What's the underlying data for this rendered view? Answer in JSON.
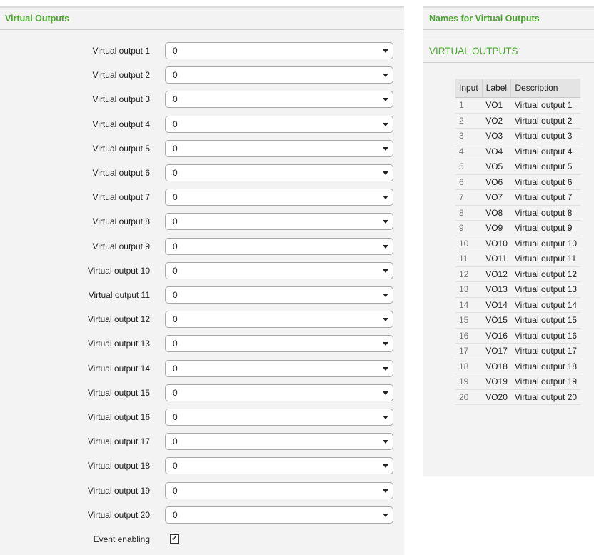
{
  "left": {
    "title": "Virtual Outputs",
    "outputs": [
      {
        "label": "Virtual output 1",
        "value": "0"
      },
      {
        "label": "Virtual output 2",
        "value": "0"
      },
      {
        "label": "Virtual output 3",
        "value": "0"
      },
      {
        "label": "Virtual output 4",
        "value": "0"
      },
      {
        "label": "Virtual output 5",
        "value": "0"
      },
      {
        "label": "Virtual output 6",
        "value": "0"
      },
      {
        "label": "Virtual output 7",
        "value": "0"
      },
      {
        "label": "Virtual output 8",
        "value": "0"
      },
      {
        "label": "Virtual output 9",
        "value": "0"
      },
      {
        "label": "Virtual output 10",
        "value": "0"
      },
      {
        "label": "Virtual output 11",
        "value": "0"
      },
      {
        "label": "Virtual output 12",
        "value": "0"
      },
      {
        "label": "Virtual output 13",
        "value": "0"
      },
      {
        "label": "Virtual output 14",
        "value": "0"
      },
      {
        "label": "Virtual output 15",
        "value": "0"
      },
      {
        "label": "Virtual output 16",
        "value": "0"
      },
      {
        "label": "Virtual output 17",
        "value": "0"
      },
      {
        "label": "Virtual output 18",
        "value": "0"
      },
      {
        "label": "Virtual output 19",
        "value": "0"
      },
      {
        "label": "Virtual output 20",
        "value": "0"
      }
    ],
    "event_enabling": {
      "label": "Event enabling",
      "checked": true,
      "mark": "✓"
    }
  },
  "right": {
    "title": "Names for Virtual Outputs",
    "subtitle": "VIRTUAL OUTPUTS",
    "columns": [
      "Input",
      "Label",
      "Description"
    ],
    "rows": [
      [
        "1",
        "VO1",
        "Virtual output 1"
      ],
      [
        "2",
        "VO2",
        "Virtual output 2"
      ],
      [
        "3",
        "VO3",
        "Virtual output 3"
      ],
      [
        "4",
        "VO4",
        "Virtual output 4"
      ],
      [
        "5",
        "VO5",
        "Virtual output 5"
      ],
      [
        "6",
        "VO6",
        "Virtual output 6"
      ],
      [
        "7",
        "VO7",
        "Virtual output 7"
      ],
      [
        "8",
        "VO8",
        "Virtual output 8"
      ],
      [
        "9",
        "VO9",
        "Virtual output 9"
      ],
      [
        "10",
        "VO10",
        "Virtual output 10"
      ],
      [
        "11",
        "VO11",
        "Virtual output 11"
      ],
      [
        "12",
        "VO12",
        "Virtual output 12"
      ],
      [
        "13",
        "VO13",
        "Virtual output 13"
      ],
      [
        "14",
        "VO14",
        "Virtual output 14"
      ],
      [
        "15",
        "VO15",
        "Virtual output 15"
      ],
      [
        "16",
        "VO16",
        "Virtual output 16"
      ],
      [
        "17",
        "VO17",
        "Virtual output 17"
      ],
      [
        "18",
        "VO18",
        "Virtual output 18"
      ],
      [
        "19",
        "VO19",
        "Virtual output 19"
      ],
      [
        "20",
        "VO20",
        "Virtual output 20"
      ]
    ]
  },
  "colors": {
    "accent": "#4aa82e",
    "panel_bg": "#f3f3f3"
  }
}
